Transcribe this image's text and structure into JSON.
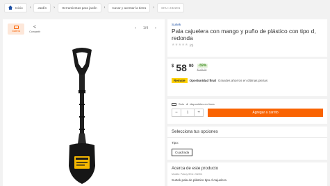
{
  "breadcrumb": {
    "home": "Inicio",
    "items": [
      "Jardín",
      "Herramientas para jardín",
      "Cavar y aventar la tierra"
    ],
    "sku": "SKU: 232201"
  },
  "media": {
    "tabs": [
      {
        "label": "Galería",
        "icon": "gallery-icon"
      },
      {
        "label": "Compartir",
        "icon": "share-icon"
      }
    ],
    "pager": "1/4",
    "prev_icon": "chevron-left-icon",
    "next_icon": "chevron-right-icon"
  },
  "product": {
    "brand": "Surtek",
    "title": "Pala cajuelera con mango y puño de plástico con tipo d, redonda",
    "stars": "★★★★★",
    "review_count": "(0)",
    "rating": 0
  },
  "price": {
    "currency": "$",
    "integer": "58",
    "decimals": "90",
    "discount": "-59%",
    "was": "$145.00"
  },
  "deal": {
    "badge": "Remate",
    "bold": "Oportunidad final",
    "text": "Grandes ahorros en últimas piezas"
  },
  "cart": {
    "stock_prefix": "Solo",
    "stock_count": "4",
    "stock_suffix": "disponibles en línea",
    "quantity": "1",
    "minus": "−",
    "plus": "+",
    "add_button": "Agregar a carrito"
  },
  "options": {
    "title": "Selecciona tus opciones",
    "type_label": "Tipo:",
    "selected": "Cuadrada"
  },
  "about": {
    "title": "Acerca de este producto",
    "meta": "Modelo: Palcoy   SKU: 232201",
    "description": "Surtek pala de plástico tipo d cajuelera"
  },
  "colors": {
    "accent": "#f96302",
    "brand_blue": "#1b4ea3",
    "deal_yellow": "#ffd200",
    "discount_green": "#3a8b1c"
  }
}
